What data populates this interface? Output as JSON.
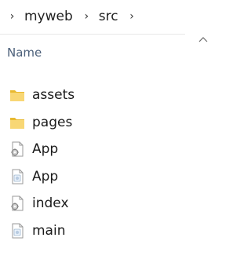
{
  "breadcrumb": {
    "segments": [
      "myweb",
      "src"
    ],
    "separator": "›"
  },
  "columns": {
    "name": "Name",
    "sort": "ascending"
  },
  "files": [
    {
      "name": "assets",
      "icon": "folder-icon",
      "type": "folder"
    },
    {
      "name": "pages",
      "icon": "folder-icon",
      "type": "folder"
    },
    {
      "name": "App",
      "icon": "settings-file-icon",
      "type": "file"
    },
    {
      "name": "App",
      "icon": "blank-settings-file-icon",
      "type": "file"
    },
    {
      "name": "index",
      "icon": "settings-file-icon",
      "type": "file"
    },
    {
      "name": "main",
      "icon": "blank-settings-file-icon",
      "type": "file"
    }
  ],
  "colors": {
    "folder": "#f8d775",
    "folder_shade": "#e8b930",
    "header_text": "#4c607a"
  }
}
